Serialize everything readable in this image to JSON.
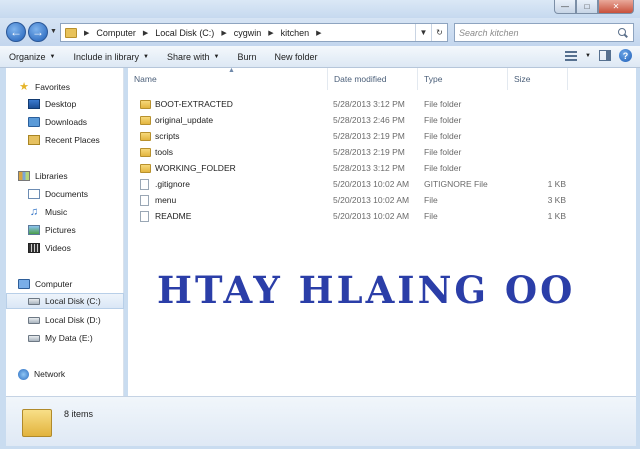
{
  "address": {
    "crumbs": [
      "Computer",
      "Local Disk (C:)",
      "cygwin",
      "kitchen"
    ]
  },
  "search": {
    "placeholder": "Search kitchen"
  },
  "toolbar": {
    "organize": "Organize",
    "include_in_library": "Include in library",
    "share_with": "Share with",
    "burn": "Burn",
    "new_folder": "New folder"
  },
  "nav": {
    "favorites": "Favorites",
    "desktop": "Desktop",
    "downloads": "Downloads",
    "recent_places": "Recent Places",
    "libraries": "Libraries",
    "documents": "Documents",
    "music": "Music",
    "pictures": "Pictures",
    "videos": "Videos",
    "computer": "Computer",
    "local_disk_c": "Local Disk (C:)",
    "local_disk_d": "Local Disk (D:)",
    "my_data_e": "My Data (E:)",
    "network": "Network"
  },
  "columns": {
    "name": "Name",
    "date": "Date modified",
    "type": "Type",
    "size": "Size"
  },
  "files": [
    {
      "name": "BOOT-EXTRACTED",
      "date": "5/28/2013 3:12 PM",
      "type": "File folder",
      "size": ""
    },
    {
      "name": "original_update",
      "date": "5/28/2013 2:46 PM",
      "type": "File folder",
      "size": ""
    },
    {
      "name": "scripts",
      "date": "5/28/2013 2:19 PM",
      "type": "File folder",
      "size": ""
    },
    {
      "name": "tools",
      "date": "5/28/2013 2:19 PM",
      "type": "File folder",
      "size": ""
    },
    {
      "name": "WORKING_FOLDER",
      "date": "5/28/2013 3:12 PM",
      "type": "File folder",
      "size": ""
    },
    {
      "name": ".gitignore",
      "date": "5/20/2013 10:02 AM",
      "type": "GITIGNORE File",
      "size": "1 KB"
    },
    {
      "name": "menu",
      "date": "5/20/2013 10:02 AM",
      "type": "File",
      "size": "3 KB"
    },
    {
      "name": "README",
      "date": "5/20/2013 10:02 AM",
      "type": "File",
      "size": "1 KB"
    }
  ],
  "watermark": "HTAY HLAING OO",
  "status": {
    "items": "8 items"
  },
  "colors": {
    "watermark": "#2b3ea8",
    "folder": "#e3b640",
    "chrome": "#c9dcf0"
  }
}
